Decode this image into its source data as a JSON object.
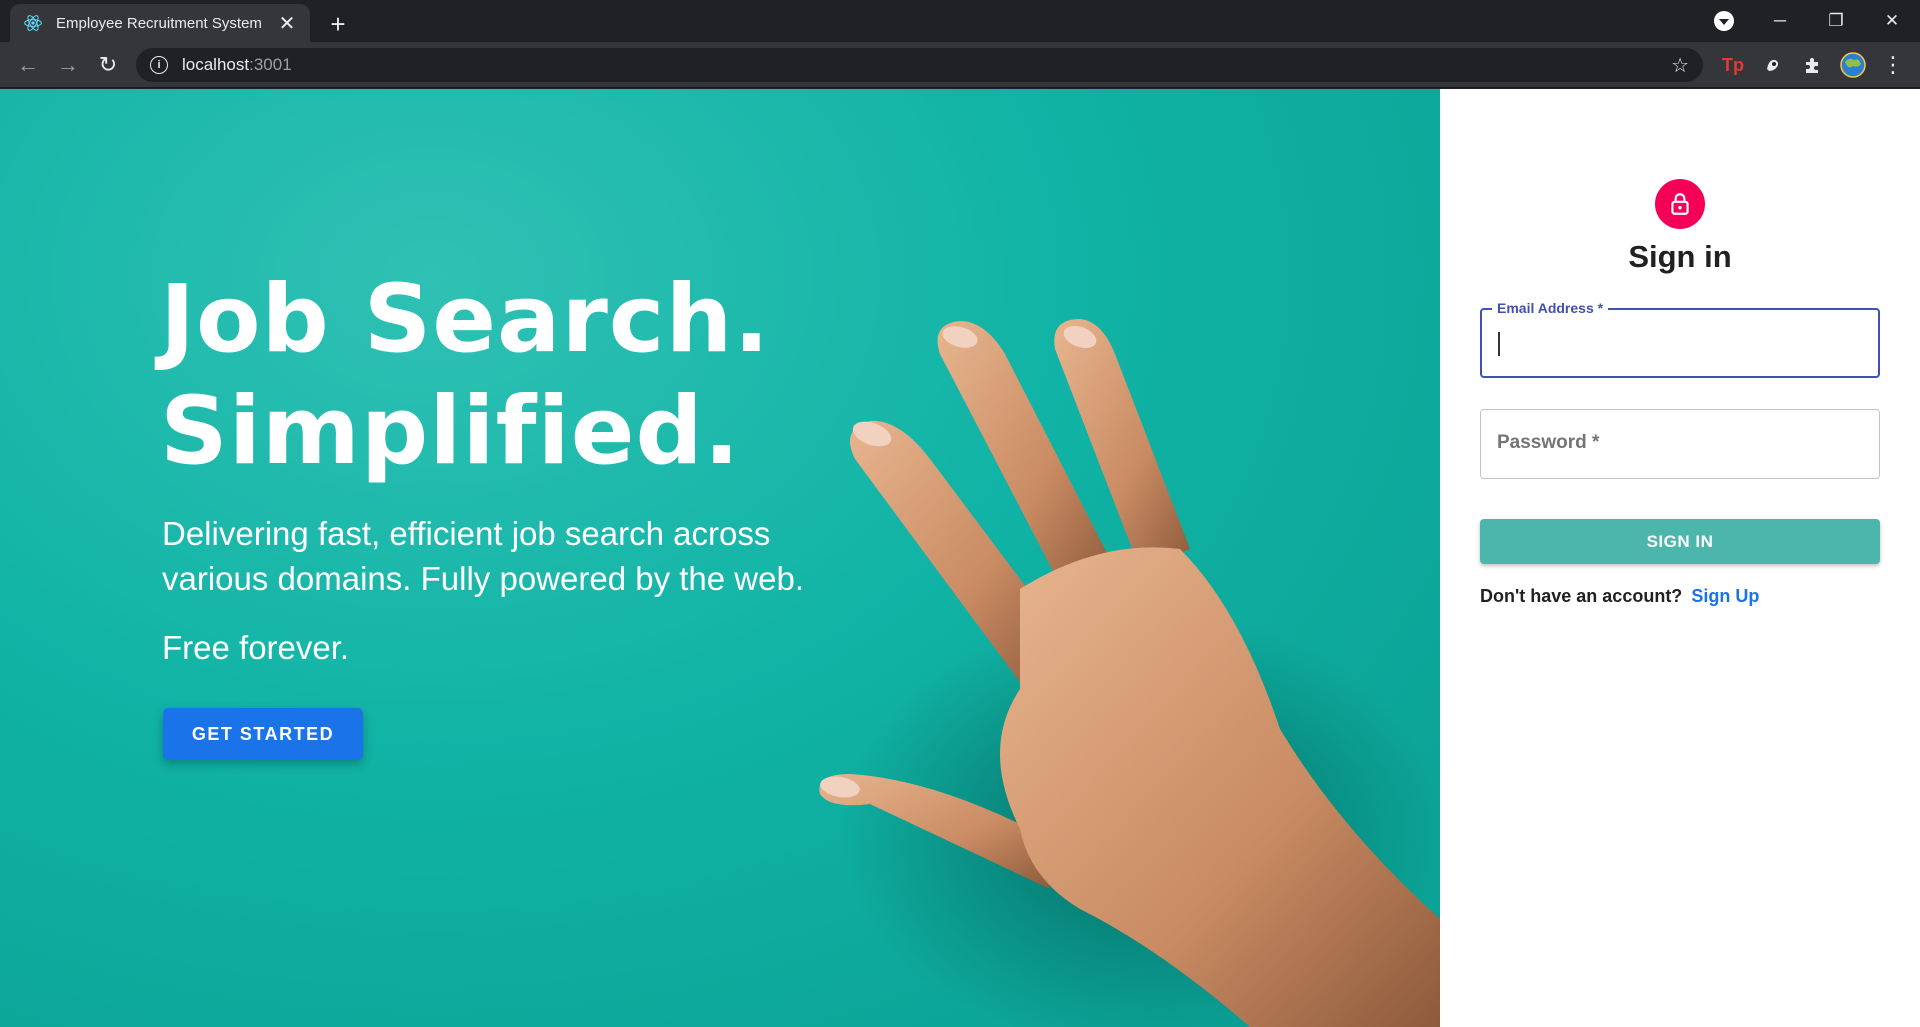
{
  "browser": {
    "tab_title": "Employee Recruitment System",
    "tab_icon": "react-icon",
    "url_host": "localhost",
    "url_port": ":3001",
    "close_glyph": "✕",
    "new_tab_glyph": "+",
    "minimize_glyph": "─",
    "restore_glyph": "❐",
    "window_close_glyph": "✕",
    "back_glyph": "←",
    "forward_glyph": "→",
    "reload_glyph": "↻",
    "star_glyph": "☆",
    "menu_glyph": "⋮",
    "ext_tp_label": "Tp"
  },
  "hero": {
    "title_line1": "Job Search.",
    "title_line2": "Simplified.",
    "subtitle": "Delivering fast, efficient job search across various domains. Fully powered by the web.",
    "free_text": "Free forever.",
    "cta_label": "GET STARTED",
    "background_color": "#10b3a5",
    "cta_color": "#1a73e8"
  },
  "signin": {
    "title": "Sign in",
    "email_label": "Email Address *",
    "email_value": "",
    "password_placeholder": "Password *",
    "submit_label": "SIGN IN",
    "no_account_text": "Don't have an account?",
    "signup_link": "Sign Up",
    "avatar_color": "#f50057",
    "button_color": "#4db6ac"
  }
}
